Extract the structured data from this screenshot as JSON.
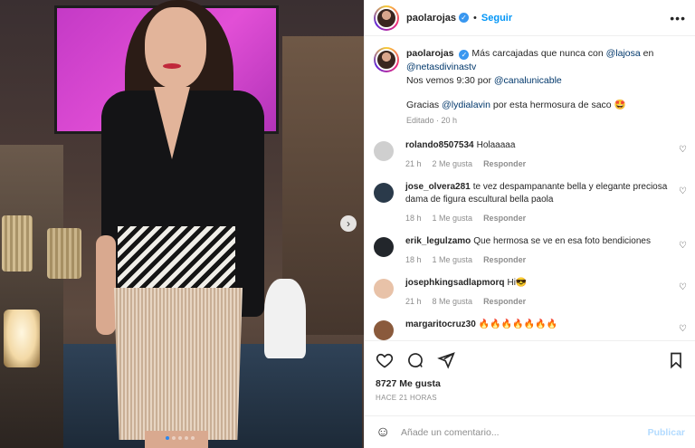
{
  "header": {
    "username": "paolarojas",
    "separator": "•",
    "follow_label": "Seguir",
    "more_label": "•••"
  },
  "caption": {
    "username": "paolarojas",
    "text_1": "Más carcajadas que nunca con",
    "mention_1": "@lajosa",
    "text_2": "en",
    "mention_2": "@netasdivinastv",
    "text_3": "Nos vemos 9:30 por",
    "mention_3": "@canalunicable",
    "text_4": "Gracias",
    "mention_4": "@lydialavin",
    "text_5": "por esta hermosura de saco 🤩",
    "meta": "Editado · 20 h"
  },
  "comments": [
    {
      "user": "rolando8507534",
      "text": "Holaaaaa",
      "time": "21 h",
      "likes": "2 Me gusta",
      "reply": "Responder",
      "avatar_color": "#cfcfcf"
    },
    {
      "user": "jose_olvera281",
      "text": "te vez despampanante bella y elegante preciosa dama de figura escultural bella paola",
      "time": "18 h",
      "likes": "1 Me gusta",
      "reply": "Responder",
      "avatar_color": "#2a3a4a"
    },
    {
      "user": "erik_legulzamo",
      "text": "Que hermosa se ve en esa foto bendiciones",
      "time": "18 h",
      "likes": "1 Me gusta",
      "reply": "Responder",
      "avatar_color": "#22262b"
    },
    {
      "user": "josephkingsadlapmorq",
      "text": "Hi😎",
      "time": "21 h",
      "likes": "8 Me gusta",
      "reply": "Responder",
      "avatar_color": "#e8c2a8"
    },
    {
      "user": "margaritocruz30",
      "text": "🔥🔥🔥🔥🔥🔥🔥",
      "time": "",
      "likes": "",
      "reply": "",
      "avatar_color": "#8a5a3c"
    }
  ],
  "actions": {
    "likes_count": "8727 Me gusta",
    "timestamp": "HACE 21 HORAS"
  },
  "composer": {
    "placeholder": "Añade un comentario...",
    "publish_label": "Publicar"
  },
  "icons": {
    "like": "heart-icon",
    "comment": "comment-icon",
    "share": "send-icon",
    "save": "bookmark-icon",
    "emoji": "emoji-icon",
    "next": "chevron-right-icon"
  },
  "colors": {
    "accent": "#0095f6",
    "verified": "#3897f0",
    "muted": "#8e8e8e",
    "publish_disabled": "#b3dbff"
  }
}
